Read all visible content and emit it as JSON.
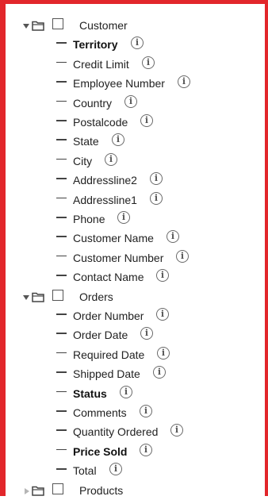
{
  "tree": {
    "groups": [
      {
        "label": "Customer",
        "expanded": true,
        "fields": [
          {
            "label": "Territory",
            "bold": true
          },
          {
            "label": "Credit Limit",
            "bold": false
          },
          {
            "label": "Employee Number",
            "bold": false
          },
          {
            "label": "Country",
            "bold": false
          },
          {
            "label": "Postalcode",
            "bold": false
          },
          {
            "label": "State",
            "bold": false
          },
          {
            "label": "City",
            "bold": false
          },
          {
            "label": "Addressline2",
            "bold": false
          },
          {
            "label": "Addressline1",
            "bold": false
          },
          {
            "label": "Phone",
            "bold": false
          },
          {
            "label": "Customer Name",
            "bold": false
          },
          {
            "label": "Customer Number",
            "bold": false
          },
          {
            "label": "Contact Name",
            "bold": false
          }
        ]
      },
      {
        "label": "Orders",
        "expanded": true,
        "fields": [
          {
            "label": "Order Number",
            "bold": false
          },
          {
            "label": "Order Date",
            "bold": false
          },
          {
            "label": "Required Date",
            "bold": false
          },
          {
            "label": "Shipped Date",
            "bold": false
          },
          {
            "label": "Status",
            "bold": true
          },
          {
            "label": "Comments",
            "bold": false
          },
          {
            "label": "Quantity Ordered",
            "bold": false
          },
          {
            "label": "Price Sold",
            "bold": true
          },
          {
            "label": "Total",
            "bold": false
          }
        ]
      },
      {
        "label": "Products",
        "expanded": false,
        "fields": []
      }
    ],
    "info_glyph": "i",
    "icons": {
      "expand": "caret-down-icon",
      "collapse": "caret-right-icon",
      "folder": "folder-icon",
      "info": "info-icon",
      "field": "dash-icon"
    }
  },
  "colors": {
    "border": "#e2262b",
    "text": "#222222",
    "icon": "#555555"
  }
}
